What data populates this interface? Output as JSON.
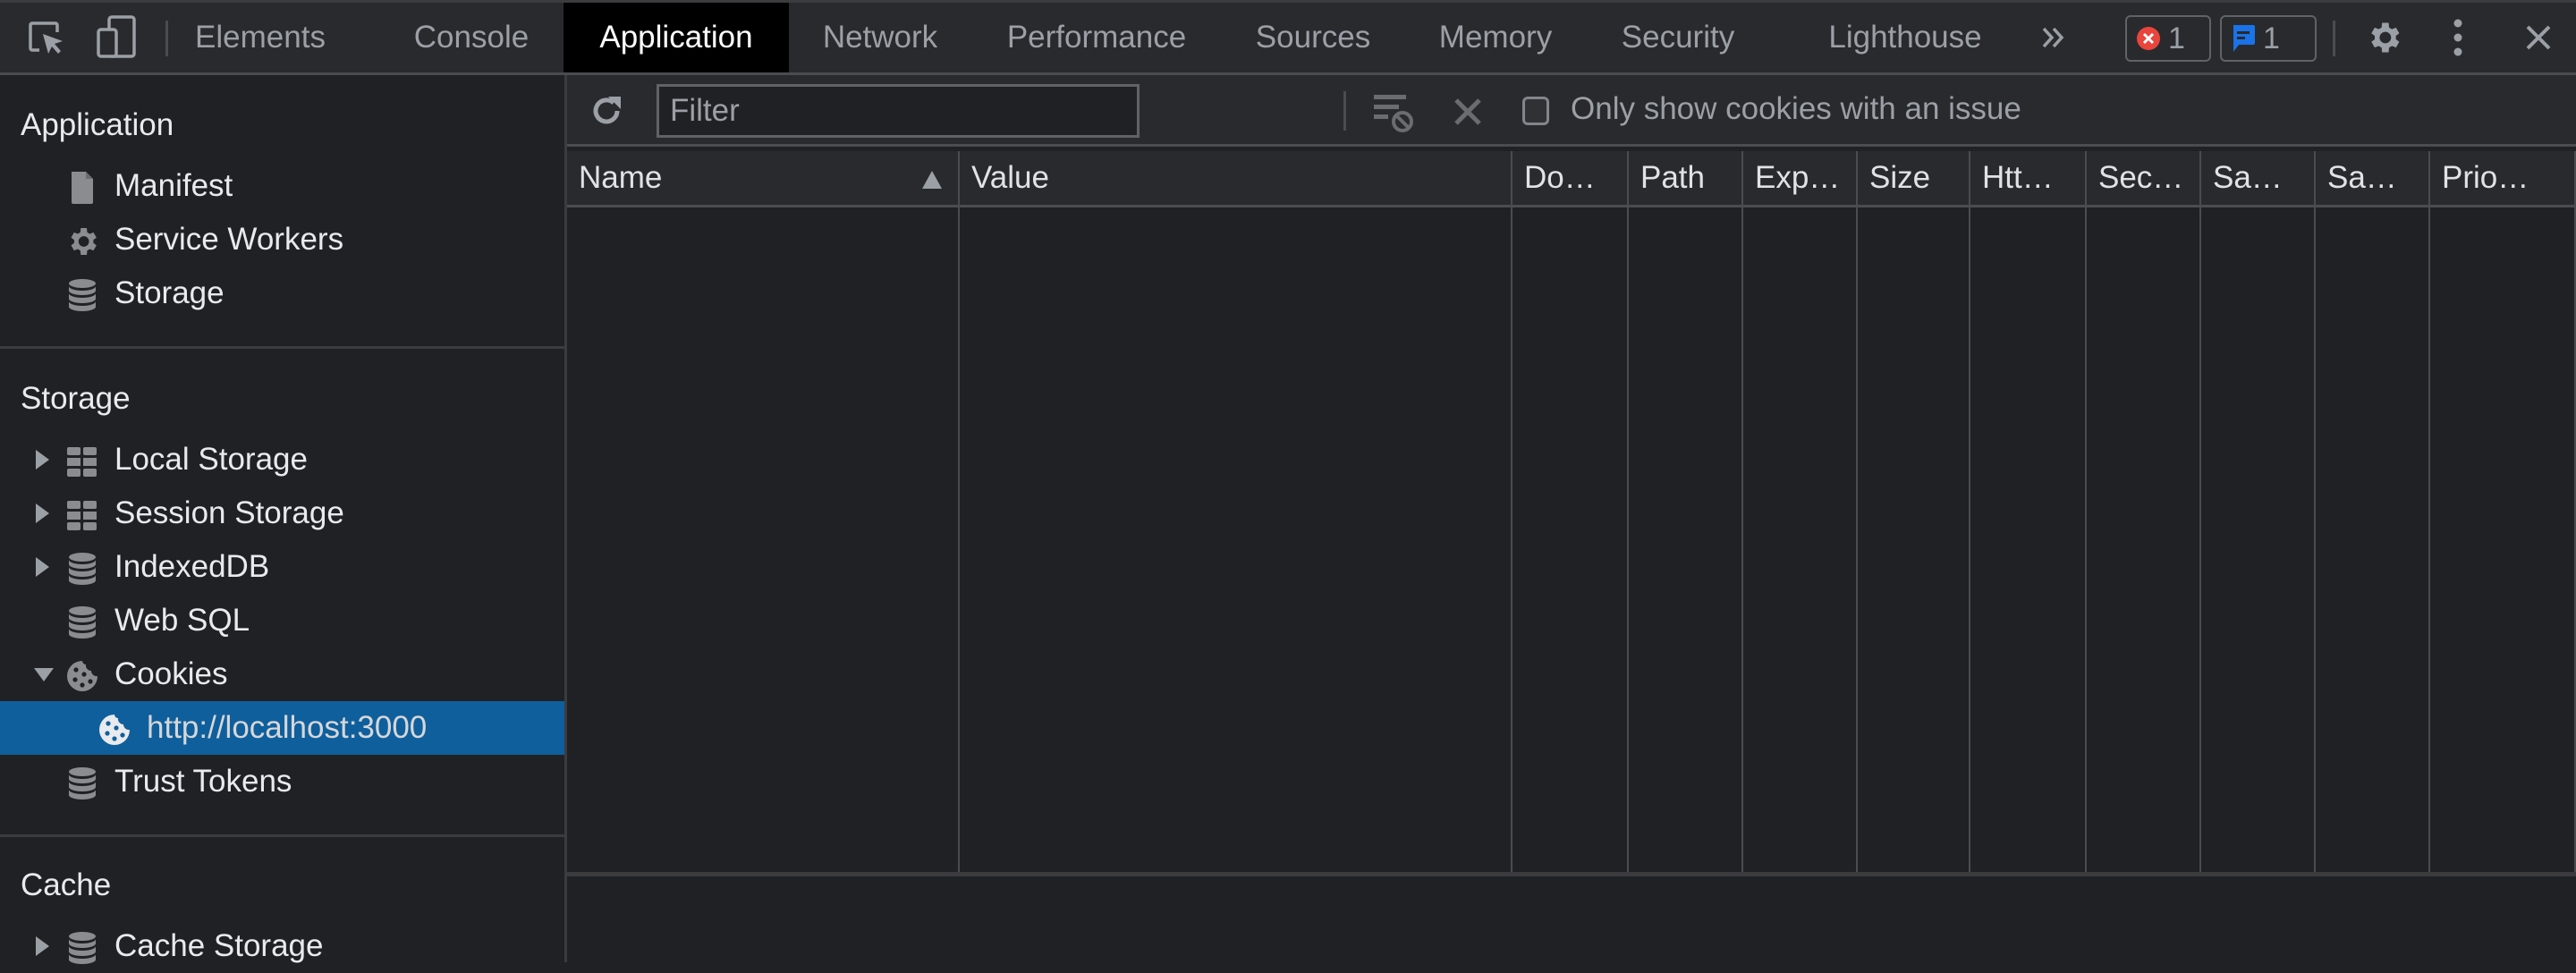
{
  "topbar": {
    "left_icons": [
      {
        "name": "inspect-element-icon"
      },
      {
        "name": "device-toolbar-icon"
      }
    ],
    "tabs": [
      {
        "label": "Elements",
        "active": false
      },
      {
        "label": "Console",
        "active": false
      },
      {
        "label": "Application",
        "active": true
      },
      {
        "label": "Network",
        "active": false
      },
      {
        "label": "Performance",
        "active": false
      },
      {
        "label": "Sources",
        "active": false
      },
      {
        "label": "Memory",
        "active": false
      },
      {
        "label": "Security",
        "active": false
      },
      {
        "label": "Lighthouse",
        "active": false
      }
    ],
    "more_tabs_icon": "chevrons-right-icon",
    "error_badge": {
      "count": "1",
      "color": "#e8453c"
    },
    "message_badge": {
      "count": "1",
      "color": "#1a73e8"
    },
    "right_icons": [
      "gear-icon",
      "kebab-menu-icon",
      "close-icon"
    ]
  },
  "sidebar": {
    "sections": [
      {
        "title": "Application",
        "items": [
          {
            "label": "Manifest",
            "icon": "document-icon"
          },
          {
            "label": "Service Workers",
            "icon": "gear-icon"
          },
          {
            "label": "Storage",
            "icon": "database-icon"
          }
        ]
      },
      {
        "title": "Storage",
        "items": [
          {
            "label": "Local Storage",
            "icon": "table-icon",
            "expander": "collapsed"
          },
          {
            "label": "Session Storage",
            "icon": "table-icon",
            "expander": "collapsed"
          },
          {
            "label": "IndexedDB",
            "icon": "database-icon",
            "expander": "collapsed"
          },
          {
            "label": "Web SQL",
            "icon": "database-icon"
          },
          {
            "label": "Cookies",
            "icon": "cookie-icon",
            "expander": "expanded"
          },
          {
            "label": "http://localhost:3000",
            "icon": "cookie-icon",
            "selected": true,
            "child": true
          },
          {
            "label": "Trust Tokens",
            "icon": "database-icon"
          }
        ]
      },
      {
        "title": "Cache",
        "items": [
          {
            "label": "Cache Storage",
            "icon": "database-icon",
            "expander": "collapsed"
          }
        ]
      }
    ],
    "selected_color": "#0f5f9c"
  },
  "toolbar": {
    "refresh_icon": "refresh-icon",
    "filter": {
      "value": "",
      "placeholder": "Filter"
    },
    "clear_filtered_icon": "filter-clear-icon",
    "delete_icon": "delete-x-icon",
    "only_issues_checkbox": {
      "label": "Only show cookies with an issue",
      "checked": false
    }
  },
  "table": {
    "columns": [
      {
        "label": "Name",
        "sorted": "ascending"
      },
      {
        "label": "Value"
      },
      {
        "label": "Do…"
      },
      {
        "label": "Path"
      },
      {
        "label": "Exp…"
      },
      {
        "label": "Size"
      },
      {
        "label": "Htt…"
      },
      {
        "label": "Sec…"
      },
      {
        "label": "Sa…"
      },
      {
        "label": "Sa…"
      },
      {
        "label": "Prio…"
      }
    ],
    "rows": []
  }
}
